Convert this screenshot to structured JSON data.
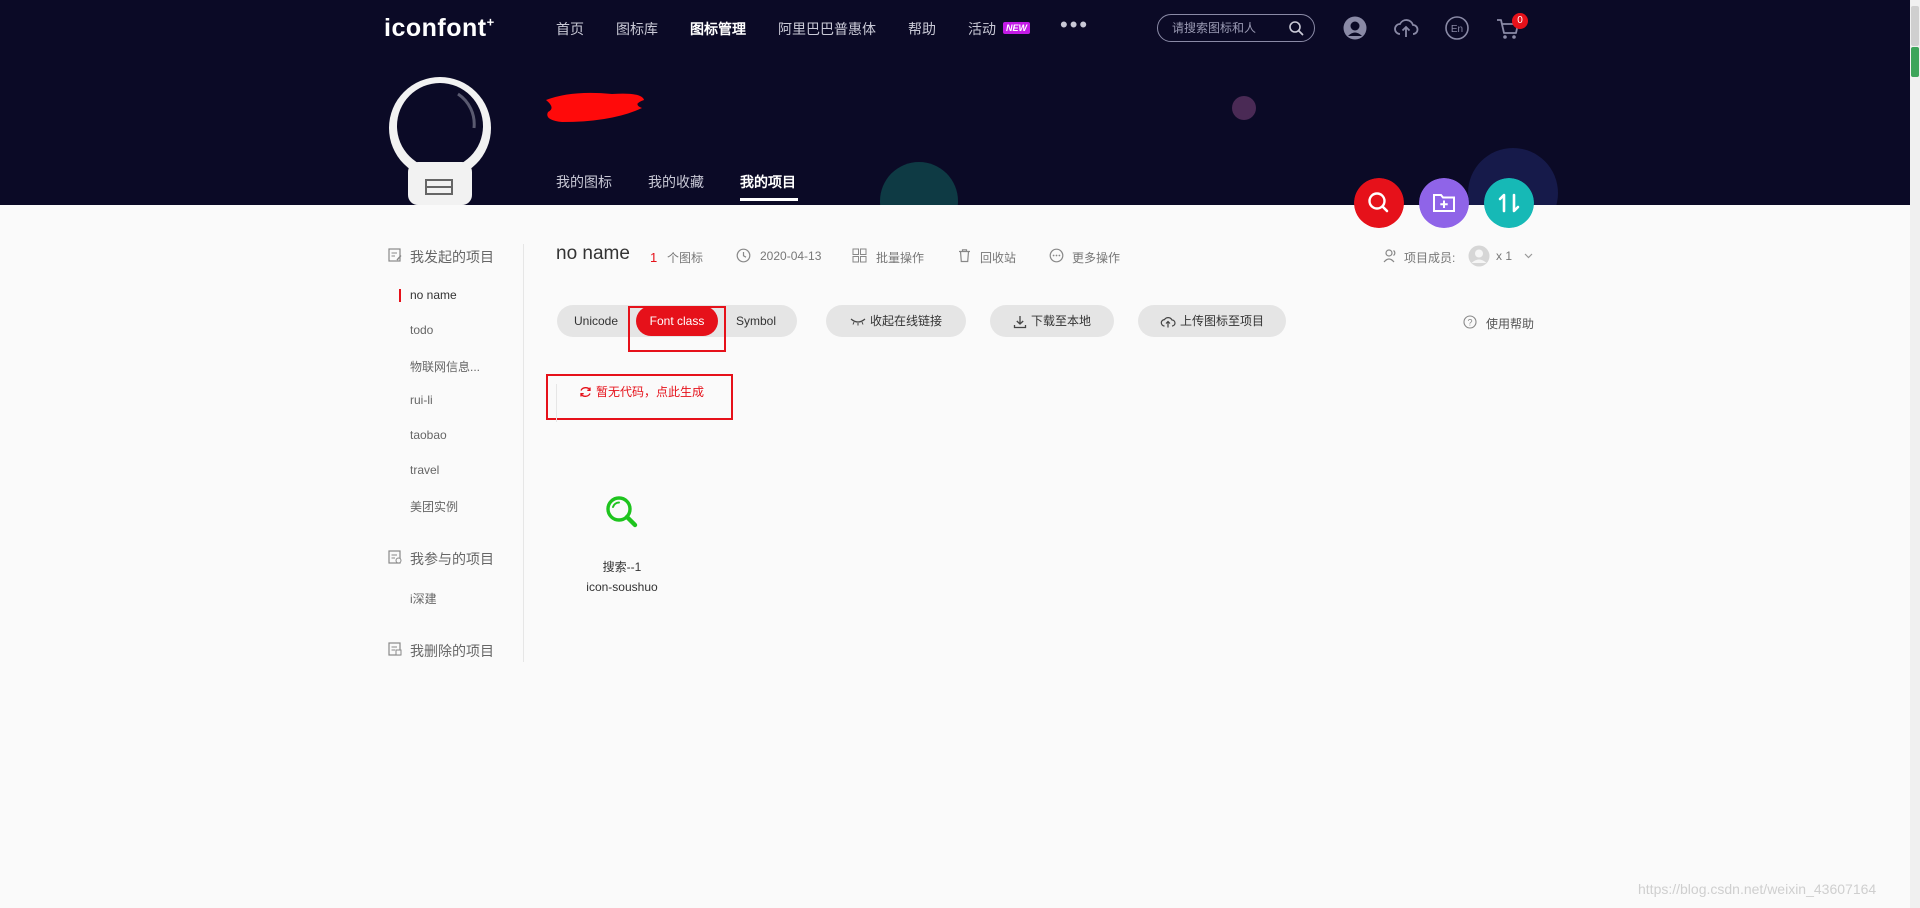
{
  "header": {
    "logo_text": "iconfont",
    "logo_mark": "+",
    "nav": [
      "首页",
      "图标库",
      "图标管理",
      "阿里巴巴普惠体",
      "帮助",
      "活动"
    ],
    "nav_new_badge": "NEW",
    "nav_more": "•••",
    "search_placeholder": "请搜索图标和人",
    "cart_count": "0"
  },
  "profile": {
    "tabs": [
      "我的图标",
      "我的收藏",
      "我的项目"
    ],
    "active_tab": "我的项目"
  },
  "sidebar": {
    "created_title": "我发起的项目",
    "created_items": [
      "no name",
      "todo",
      "物联网信息...",
      "rui-li",
      "taobao",
      "travel",
      "美团实例"
    ],
    "joined_title": "我参与的项目",
    "joined_items": [
      "i深建"
    ],
    "deleted_title": "我删除的项目"
  },
  "project": {
    "name": "no name",
    "icon_count": "1",
    "icon_count_label": "个图标",
    "date": "2020-04-13",
    "batch": "批量操作",
    "recycle": "回收站",
    "more": "更多操作",
    "members_label": "项目成员:",
    "members_count": "x 1",
    "tabs": [
      "Unicode",
      "Font class",
      "Symbol"
    ],
    "active_tab": "Font class",
    "collapse_link": "收起在线链接",
    "download": "下载至本地",
    "upload": "上传图标至项目",
    "help": "使用帮助",
    "generate_code": "暂无代码，点此生成"
  },
  "icons": [
    {
      "name": "搜索--1",
      "code": "icon-soushuo"
    }
  ],
  "watermark": "https://blog.csdn.net/weixin_43607164",
  "colors": {
    "header_bg": "#0b0a26",
    "accent_red": "#e6111a",
    "fab_purple": "#8f64e8",
    "fab_teal": "#16b9b6",
    "icon_green": "#1ec41e"
  }
}
